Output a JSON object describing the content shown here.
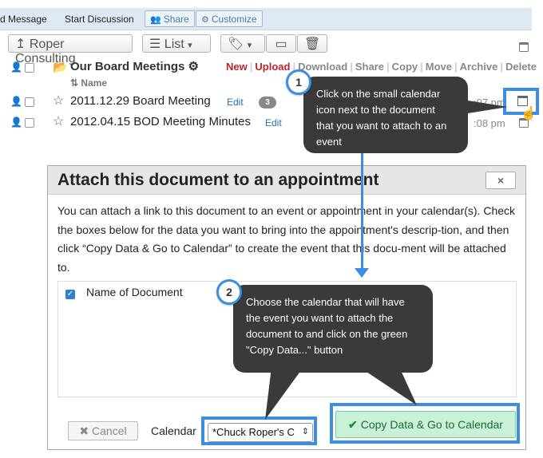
{
  "topbar": {
    "message": "d Message",
    "start_discussion": "Start Discussion",
    "share": "Share",
    "customize": "Customize"
  },
  "row2": {
    "workspace": "Roper Consulting",
    "workspace_prefix": "↥",
    "view": "List",
    "view_caret": "▾",
    "tag_caret": "▾"
  },
  "folder": {
    "name": "Our Board Meetings",
    "gear": "⚙",
    "actions": [
      "New",
      "Upload",
      "Download",
      "Share",
      "Copy",
      "Move",
      "Archive",
      "Delete"
    ]
  },
  "sort_header": "Name",
  "sort_icon": "⇅",
  "documents": [
    {
      "name": "2011.12.29 Board Meeting",
      "edit": "Edit",
      "badge": "3",
      "time": ":07 pm"
    },
    {
      "name": "2012.04.15 BOD Meeting Minutes",
      "edit": "Edit",
      "time": ":08 pm"
    }
  ],
  "callout1": {
    "number": "1",
    "text": "Click on the small calendar icon next to the document that you want to attach to an event"
  },
  "callout2": {
    "number": "2",
    "text": "Choose the calendar that will have the event you want to attach the document to and click on the green \"Copy Data...\" button"
  },
  "modal": {
    "title": "Attach this document to an appointment",
    "close": "×",
    "body": "You can attach a link to this document to an event or appointment in your calendar(s). Check the boxes below for the data you want to bring into the appointment's descrip-tion, and then click “Copy Data & Go to Calendar” to create the event that this docu-ment will be attached to.",
    "checkbox_label": "Name of Document",
    "checkbox_mark": "✓",
    "cancel": "Cancel",
    "cancel_icon": "✖",
    "calendar_label": "Calendar",
    "calendar_value": "*Chuck Roper's C",
    "copy_button": "Copy Data & Go to Calendar",
    "copy_icon": "✔"
  },
  "colors": {
    "highlight": "#3b8ee0",
    "callout_bg": "#3a3a3a",
    "copy_bg": "#c9f0d8",
    "action_red": "#c0212b"
  }
}
